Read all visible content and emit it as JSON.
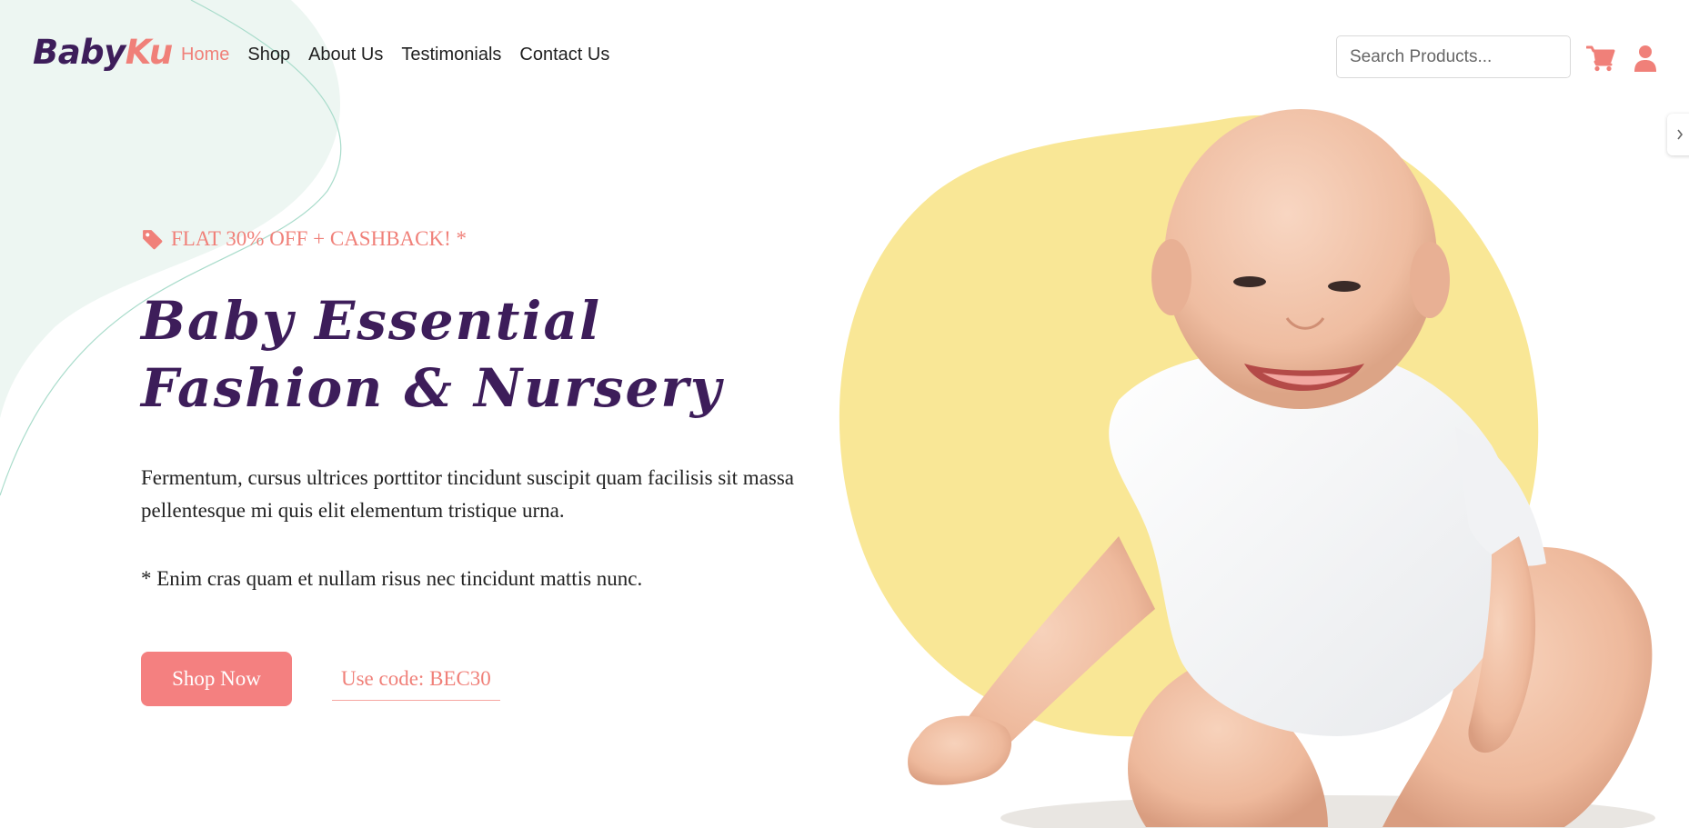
{
  "brand": {
    "part1": "Baby",
    "part2": "Ku"
  },
  "nav": {
    "items": [
      {
        "label": "Home",
        "active": true
      },
      {
        "label": "Shop",
        "active": false
      },
      {
        "label": "About Us",
        "active": false
      },
      {
        "label": "Testimonials",
        "active": false
      },
      {
        "label": "Contact Us",
        "active": false
      }
    ]
  },
  "search": {
    "placeholder": "Search Products...",
    "value": ""
  },
  "icons": {
    "cart": "cart-icon",
    "user": "user-icon",
    "promo": "tag-icon",
    "side_tab": "chevron-right-icon"
  },
  "hero": {
    "promo": "FLAT 30% OFF + CASHBACK! *",
    "headline_line1": "Baby Essential",
    "headline_line2": "Fashion & Nursery",
    "description": "Fermentum, cursus ultrices porttitor tincidunt suscipit quam facilisis sit massa pellentesque mi quis elit elementum tristique urna.",
    "note": "* Enim cras quam et nullam risus nec tincidunt mattis nunc.",
    "cta_label": "Shop Now",
    "code_label": "Use code: BEC30"
  },
  "colors": {
    "primary_purple": "#3d1d5a",
    "accent_coral": "#f08079",
    "button_coral": "#f48080",
    "blob_mint": "#edf6f2",
    "blob_yellow": "#f9e796"
  }
}
